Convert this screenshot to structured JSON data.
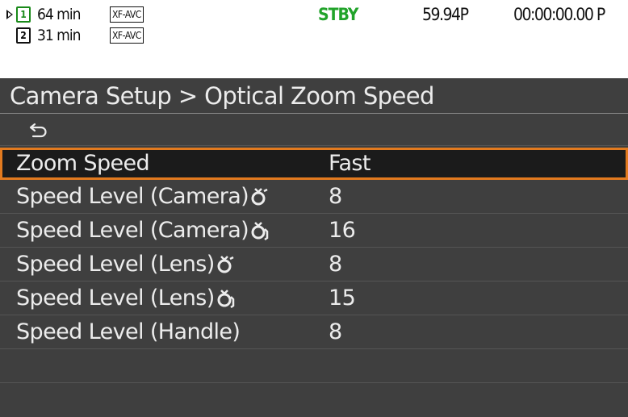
{
  "status_bar": {
    "media": [
      {
        "slot": "1",
        "remaining": "64 min",
        "codec": "XF-AVC",
        "active": true
      },
      {
        "slot": "2",
        "remaining": "31 min",
        "codec": "XF-AVC",
        "active": false
      }
    ],
    "record_state": "STBY",
    "frame_rate": "59.94P",
    "timecode": "00:00:00.00 P",
    "colors": {
      "stby": "#21a32a",
      "active_slot": "#1a8a1a"
    }
  },
  "menu": {
    "breadcrumb": "Camera Setup > Optical Zoom Speed",
    "back_icon": "return-arrow-icon",
    "selection_color": "#e27a1f",
    "items": [
      {
        "label": "Zoom Speed",
        "value": "Fast",
        "icon": null
      },
      {
        "label": "Speed Level (Camera)",
        "value": "8",
        "icon": "zoom-tele-icon"
      },
      {
        "label": "Speed Level (Camera)",
        "value": "16",
        "icon": "zoom-wide-icon"
      },
      {
        "label": "Speed Level (Lens)",
        "value": "8",
        "icon": "zoom-tele-icon"
      },
      {
        "label": "Speed Level (Lens)",
        "value": "15",
        "icon": "zoom-wide-icon"
      },
      {
        "label": "Speed Level (Handle)",
        "value": "8",
        "icon": null
      }
    ]
  }
}
